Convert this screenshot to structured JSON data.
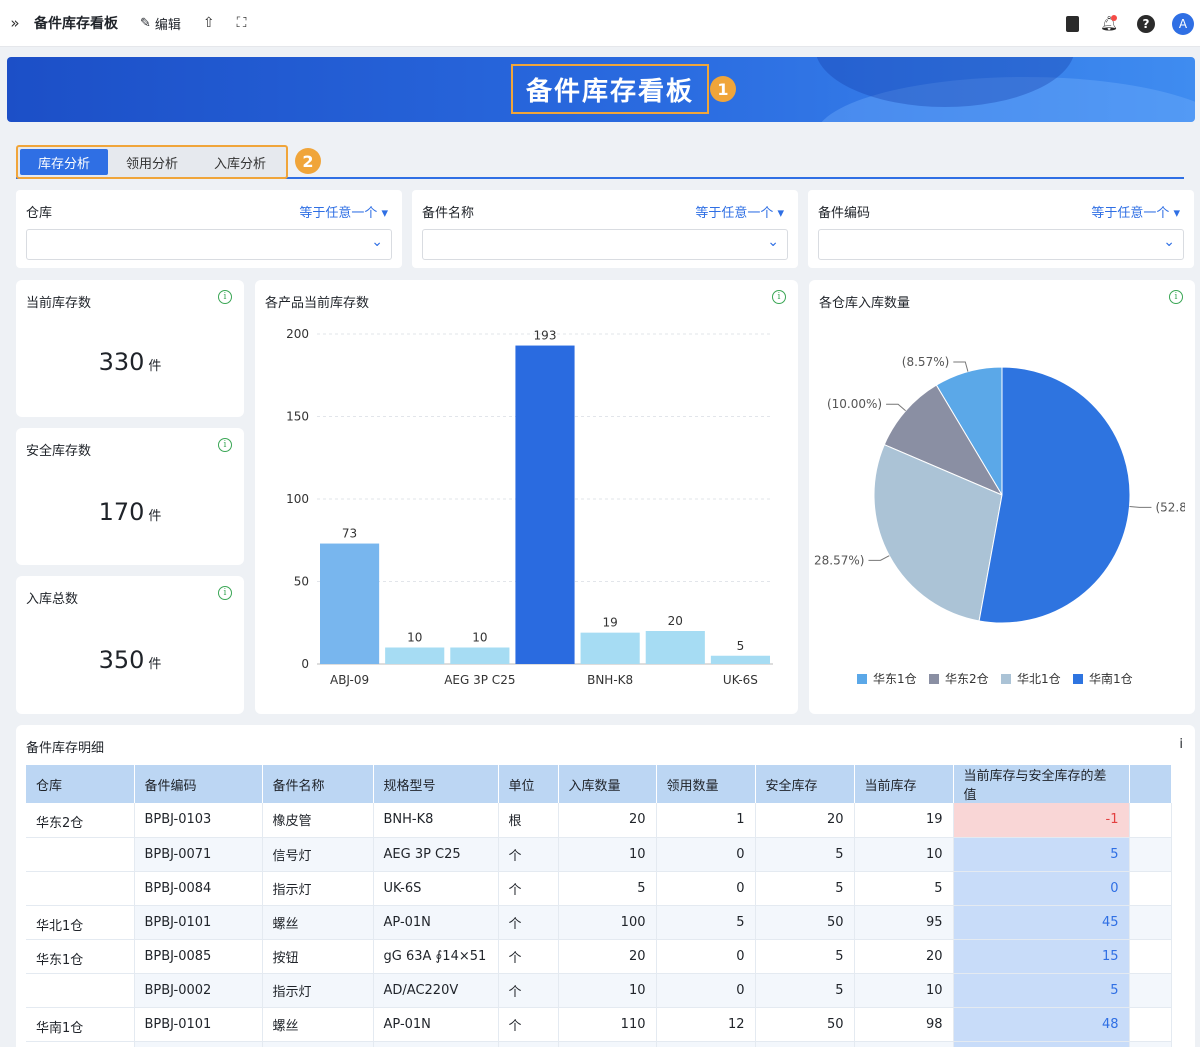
{
  "topbar": {
    "title": "备件库存看板",
    "edit_label": "编辑",
    "avatar_initial": "A"
  },
  "banner": {
    "title": "备件库存看板",
    "badge": "1"
  },
  "tabs": {
    "items": [
      "库存分析",
      "领用分析",
      "入库分析"
    ],
    "active": 0,
    "badge": "2"
  },
  "filters": [
    {
      "label": "仓库",
      "operator": "等于任意一个"
    },
    {
      "label": "备件名称",
      "operator": "等于任意一个"
    },
    {
      "label": "备件编码",
      "operator": "等于任意一个"
    }
  ],
  "kpis": [
    {
      "label": "当前库存数",
      "value": "330",
      "unit": "件"
    },
    {
      "label": "安全库存数",
      "value": "170",
      "unit": "件"
    },
    {
      "label": "入库总数",
      "value": "350",
      "unit": "件"
    }
  ],
  "bar_chart": {
    "title": "各产品当前库存数"
  },
  "pie_chart": {
    "title": "各仓库入库数量"
  },
  "chart_data": [
    {
      "type": "bar",
      "title": "各产品当前库存数",
      "categories": [
        "ABJ-09",
        "",
        "AEG 3P C25",
        "",
        "BNH-K8",
        "",
        "UK-6S"
      ],
      "values": [
        73,
        10,
        10,
        193,
        19,
        20,
        5
      ],
      "colors": [
        "#78b6ee",
        "#a6dcf3",
        "#a6dcf3",
        "#2a6be0",
        "#a6dcf3",
        "#a6dcf3",
        "#a6dcf3"
      ],
      "ylim": [
        0,
        200
      ],
      "yticks": [
        0,
        50,
        100,
        150,
        200
      ],
      "grid": true
    },
    {
      "type": "pie",
      "title": "各仓库入库数量",
      "labels": [
        "华东1仓",
        "华东2仓",
        "华北1仓",
        "华南1仓"
      ],
      "values": [
        8.57,
        10.0,
        28.57,
        52.86
      ],
      "slice_labels": [
        "(8.57%)",
        "(10.00%)",
        "28.57%)",
        "(52.8"
      ],
      "colors": [
        "#5ba8e8",
        "#8a8fa3",
        "#abc3d6",
        "#2e74e0"
      ],
      "legend": "bottom"
    }
  ],
  "table": {
    "title": "备件库存明细",
    "headers": [
      "仓库",
      "备件编码",
      "备件名称",
      "规格型号",
      "单位",
      "入库数量",
      "领用数量",
      "安全库存",
      "当前库存",
      "当前库存与安全库存的差值"
    ],
    "rows": [
      {
        "warehouse": "华东2仓",
        "code": "BPBJ-0103",
        "name": "橡皮管",
        "spec": "BNH-K8",
        "unit": "根",
        "in": "20",
        "used": "1",
        "safe": "20",
        "current": "19",
        "diff": "-1",
        "neg": true
      },
      {
        "warehouse": "",
        "code": "BPBJ-0071",
        "name": "信号灯",
        "spec": "AEG 3P C25",
        "unit": "个",
        "in": "10",
        "used": "0",
        "safe": "5",
        "current": "10",
        "diff": "5",
        "neg": false
      },
      {
        "warehouse": "",
        "code": "BPBJ-0084",
        "name": "指示灯",
        "spec": "UK-6S",
        "unit": "个",
        "in": "5",
        "used": "0",
        "safe": "5",
        "current": "5",
        "diff": "0",
        "neg": false
      },
      {
        "warehouse": "华北1仓",
        "code": "BPBJ-0101",
        "name": "螺丝",
        "spec": "AP-01N",
        "unit": "个",
        "in": "100",
        "used": "5",
        "safe": "50",
        "current": "95",
        "diff": "45",
        "neg": false
      },
      {
        "warehouse": "华东1仓",
        "code": "BPBJ-0085",
        "name": "按钮",
        "spec": "gG 63A ∮14×51",
        "unit": "个",
        "in": "20",
        "used": "0",
        "safe": "5",
        "current": "20",
        "diff": "15",
        "neg": false
      },
      {
        "warehouse": "",
        "code": "BPBJ-0002",
        "name": "指示灯",
        "spec": "AD/AC220V",
        "unit": "个",
        "in": "10",
        "used": "0",
        "safe": "5",
        "current": "10",
        "diff": "5",
        "neg": false
      },
      {
        "warehouse": "华南1仓",
        "code": "BPBJ-0101",
        "name": "螺丝",
        "spec": "AP-01N",
        "unit": "个",
        "in": "110",
        "used": "12",
        "safe": "50",
        "current": "98",
        "diff": "48",
        "neg": false
      },
      {
        "warehouse": "",
        "code": "",
        "name": "",
        "spec": "",
        "unit": "",
        "in": "",
        "used": "",
        "safe": "",
        "current": "",
        "diff": "",
        "neg": false
      }
    ]
  }
}
